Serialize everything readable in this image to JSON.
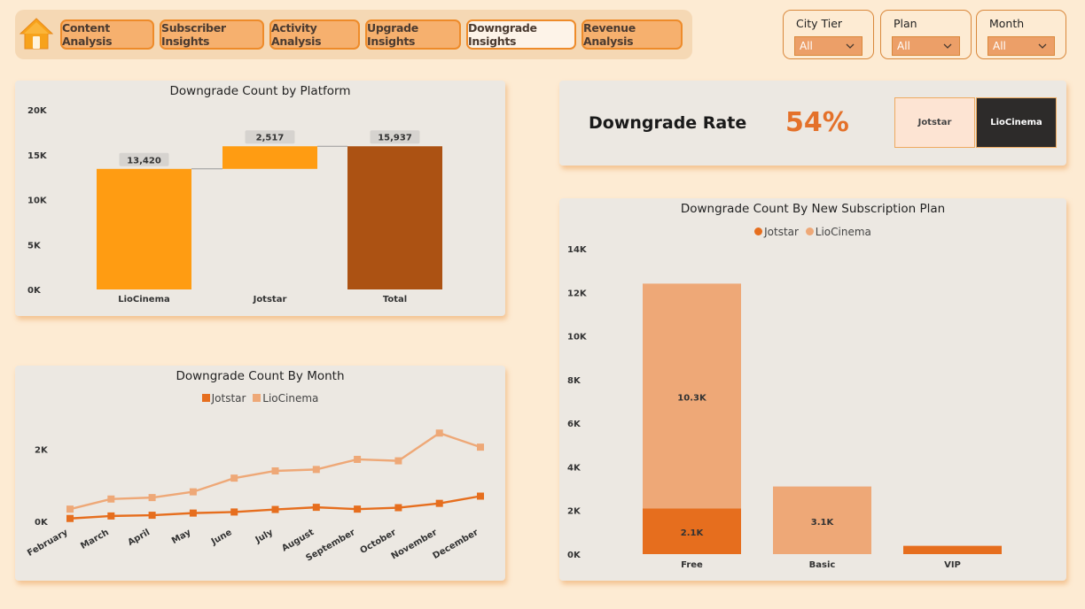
{
  "nav": {
    "items": [
      {
        "label": "Content Analysis",
        "active": false
      },
      {
        "label": "Subscriber Insights",
        "active": false
      },
      {
        "label": "Activity Analysis",
        "active": false
      },
      {
        "label": "Upgrade Insights",
        "active": false
      },
      {
        "label": "Downgrade Insights",
        "active": true
      },
      {
        "label": "Revenue Analysis",
        "active": false
      }
    ],
    "home_icon": "home-icon"
  },
  "slicers": [
    {
      "label": "City Tier",
      "value": "All"
    },
    {
      "label": "Plan",
      "value": "All"
    },
    {
      "label": "Month",
      "value": "All"
    }
  ],
  "kpi": {
    "title": "Downgrade Rate",
    "value": "54%",
    "platform_buttons": [
      {
        "label": "Jotstar",
        "selected": false
      },
      {
        "label": "LioCinema",
        "selected": true
      }
    ]
  },
  "colors": {
    "background": "#fdebd3",
    "accent": "#e4712a",
    "jotstar": "#e66e1e",
    "liocinema": "#eea877",
    "waterfall_lio": "#ff9c12",
    "waterfall_total": "#ac5213"
  },
  "chart_data": [
    {
      "type": "bar",
      "subtype": "waterfall",
      "title": "Downgrade Count by Platform",
      "categories": [
        "LioCinema",
        "Jotstar",
        "Total"
      ],
      "values": [
        13420,
        2517,
        15937
      ],
      "data_labels": [
        "13,420",
        "2,517",
        "15,937"
      ],
      "yticks": [
        "0K",
        "5K",
        "10K",
        "15K",
        "20K"
      ],
      "ylim": [
        0,
        20000
      ],
      "grid": false
    },
    {
      "type": "line",
      "title": "Downgrade Count By Month",
      "legend": [
        "Jotstar",
        "LioCinema"
      ],
      "legend_position": "top",
      "x": [
        "February",
        "March",
        "April",
        "May",
        "June",
        "July",
        "August",
        "September",
        "October",
        "November",
        "December"
      ],
      "series": [
        {
          "name": "Jotstar",
          "values": [
            80,
            150,
            170,
            230,
            260,
            330,
            390,
            340,
            380,
            500,
            700
          ]
        },
        {
          "name": "LioCinema",
          "values": [
            340,
            620,
            660,
            820,
            1200,
            1400,
            1440,
            1720,
            1680,
            2450,
            2060
          ]
        }
      ],
      "yticks": [
        "0K",
        "2K"
      ],
      "ylim": [
        0,
        2800
      ],
      "grid": false
    },
    {
      "type": "bar",
      "subtype": "stacked",
      "title": "Downgrade Count By New Subscription Plan",
      "legend": [
        "Jotstar",
        "LioCinema"
      ],
      "legend_position": "top",
      "categories": [
        "Free",
        "Basic",
        "VIP"
      ],
      "series": [
        {
          "name": "Jotstar",
          "values": [
            2100,
            0,
            380
          ],
          "data_labels": [
            "2.1K",
            "",
            ""
          ]
        },
        {
          "name": "LioCinema",
          "values": [
            10300,
            3100,
            0
          ],
          "data_labels": [
            "10.3K",
            "3.1K",
            ""
          ]
        }
      ],
      "yticks": [
        "0K",
        "2K",
        "4K",
        "6K",
        "8K",
        "10K",
        "12K",
        "14K"
      ],
      "ylim": [
        0,
        14000
      ],
      "grid": false
    }
  ]
}
